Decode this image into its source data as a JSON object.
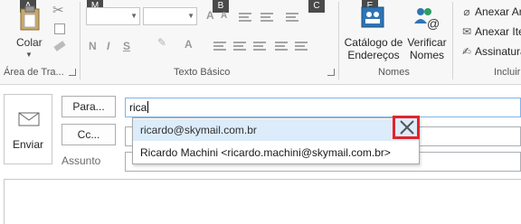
{
  "ribbon": {
    "clipboard": {
      "paste_label": "Colar",
      "group_label": "Área de Tra...",
      "keytip": "A"
    },
    "basic_text": {
      "group_label": "Texto Básico",
      "keytips": [
        "M",
        "B",
        "C"
      ]
    },
    "names": {
      "address_book_label": "Catálogo de Endereços",
      "check_names_label": "Verificar Nomes",
      "group_label": "Nomes",
      "keytip": "E"
    },
    "include": {
      "attach_file": "Anexar Ar",
      "attach_item": "Anexar Ite",
      "signature": "Assinatura",
      "group_label": "Incluir"
    }
  },
  "compose": {
    "send_label": "Enviar",
    "to_button": "Para...",
    "cc_button": "Cc...",
    "subject_label": "Assunto",
    "to_value": "rica"
  },
  "autocomplete": {
    "items": [
      "ricardo@skymail.com.br",
      "Ricardo Machini <ricardo.machini@skymail.com.br>"
    ],
    "highlight_color": "#e2242b"
  }
}
